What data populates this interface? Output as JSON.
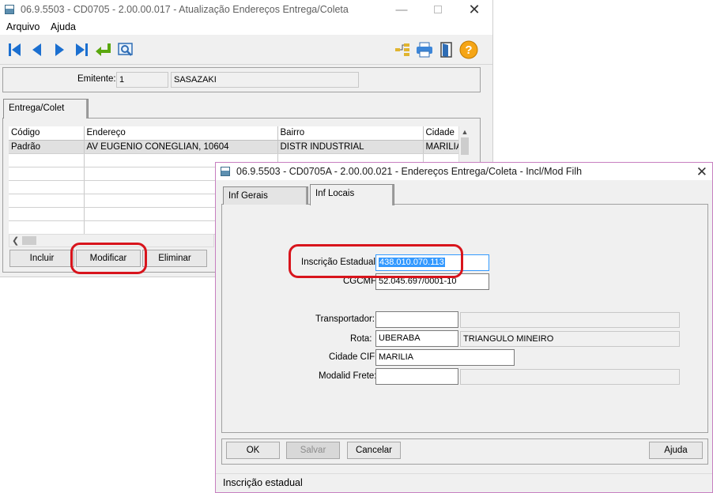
{
  "main_window": {
    "title": "06.9.5503 - CD0705 - 2.00.00.017 - Atualização Endereços Entrega/Coleta",
    "menu": [
      "Arquivo",
      "Ajuda"
    ],
    "emitente_label": "Emitente:",
    "emitente_code": "1",
    "emitente_name": "SASAZAKI",
    "tab_label": "Entrega/Colet",
    "columns": [
      "Código",
      "Endereço",
      "Bairro",
      "Cidade"
    ],
    "rows": [
      [
        "Padrão",
        "AV EUGENIO CONEGLIAN, 10604",
        "DISTR INDUSTRIAL",
        "MARILIA"
      ]
    ],
    "buttons": {
      "incluir": "Incluir",
      "modificar": "Modificar",
      "eliminar": "Eliminar"
    }
  },
  "dialog": {
    "title": "06.9.5503 - CD0705A - 2.00.00.021 - Endereços Entrega/Coleta - Incl/Mod Filh",
    "tabs": [
      "Inf Gerais",
      "Inf Locais"
    ],
    "fields": {
      "inscricao_label": "Inscrição Estadual:",
      "inscricao_value": "438.010.070.113",
      "cgcmf_label": "CGCMF:",
      "cgcmf_value": "52.045.697/0001-10",
      "transportador_label": "Transportador:",
      "transportador_value": "",
      "rota_label": "Rota:",
      "rota_value": "UBERABA",
      "rota_desc": "TRIANGULO MINEIRO",
      "cidade_label": "Cidade CIF:",
      "cidade_value": "MARILIA",
      "frete_label": "Modalid Frete:",
      "frete_value": ""
    },
    "buttons": {
      "ok": "OK",
      "salvar": "Salvar",
      "cancelar": "Cancelar",
      "ajuda": "Ajuda"
    },
    "status": "Inscrição estadual"
  },
  "colors": {
    "annotation": "#d8141c",
    "dialog_border": "#c77fc0",
    "selection": "#3399ff"
  }
}
